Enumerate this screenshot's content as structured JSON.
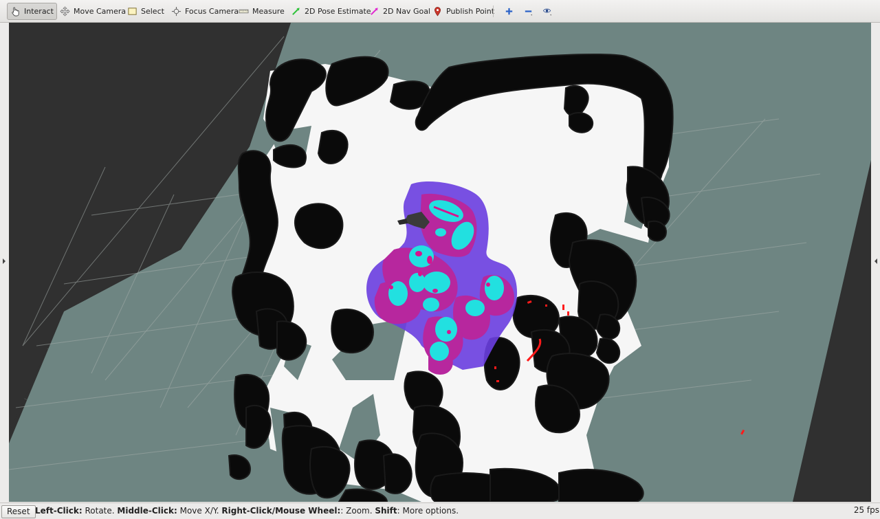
{
  "toolbar": {
    "tools": [
      {
        "label": "Interact",
        "icon": "hand-pointer-icon",
        "active": true
      },
      {
        "label": "Move Camera",
        "icon": "move-arrows-icon"
      },
      {
        "label": "Select",
        "icon": "select-box-icon"
      },
      {
        "label": "Focus Camera",
        "icon": "focus-target-icon"
      },
      {
        "label": "Measure",
        "icon": "ruler-icon"
      },
      {
        "label": "2D Pose Estimate",
        "icon": "green-arrow-icon"
      },
      {
        "label": "2D Nav Goal",
        "icon": "magenta-arrow-icon"
      },
      {
        "label": "Publish Point",
        "icon": "map-pin-icon"
      }
    ],
    "extra_icons": [
      "add-tool-icon",
      "remove-tool-icon",
      "view-options-icon"
    ]
  },
  "statusbar": {
    "reset_label": "Reset",
    "hint_left_click": "Left-Click:",
    "hint_left_click_action": " Rotate. ",
    "hint_middle_click": "Middle-Click:",
    "hint_middle_click_action": " Move X/Y. ",
    "hint_right_click": "Right-Click/Mouse Wheel:",
    "hint_right_click_action": ": Zoom. ",
    "hint_shift": "Shift",
    "hint_shift_action": ": More options.",
    "fps": "25 fps"
  },
  "colors": {
    "background": "#303030",
    "unknown_area": "#6e8582",
    "free_space": "#f6f6f6",
    "obstacle": "#0a0a0a",
    "costmap_outer": "#6a3ee0",
    "costmap_mid": "#d01a6e",
    "costmap_lethal": "#22e0e0",
    "laser_points": "#ff1a1a",
    "grid_lines": "#9aa09e"
  }
}
